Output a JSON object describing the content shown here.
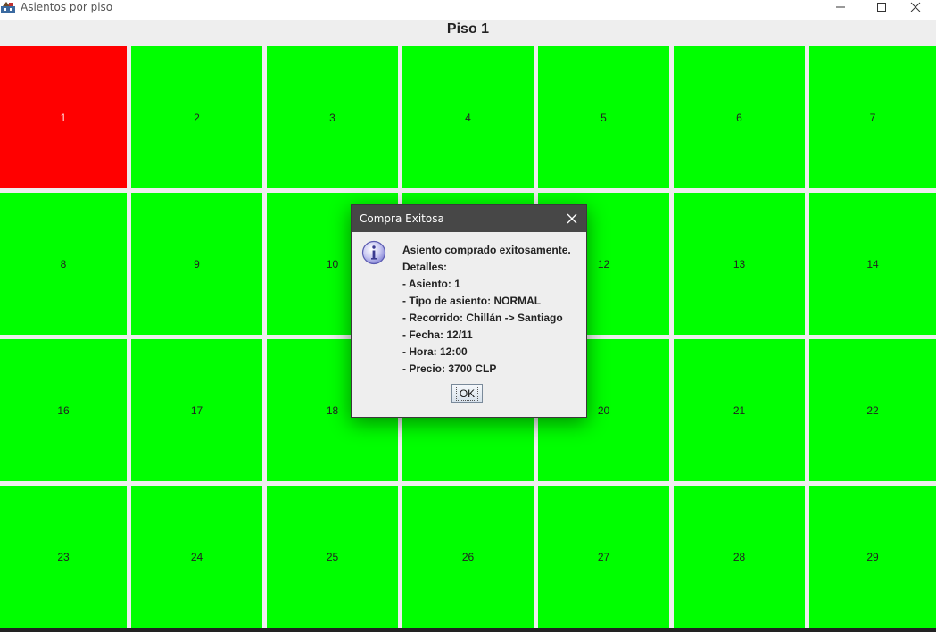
{
  "window": {
    "title": "Asientos por piso",
    "icon": "app-icon"
  },
  "floor": {
    "title": "Piso 1"
  },
  "colors": {
    "available": "#00ff00",
    "sold": "#ff0000"
  },
  "seats": [
    {
      "number": "1",
      "status": "sold"
    },
    {
      "number": "2",
      "status": "available"
    },
    {
      "number": "3",
      "status": "available"
    },
    {
      "number": "4",
      "status": "available"
    },
    {
      "number": "5",
      "status": "available"
    },
    {
      "number": "6",
      "status": "available"
    },
    {
      "number": "7",
      "status": "available"
    },
    {
      "number": "8",
      "status": "available"
    },
    {
      "number": "9",
      "status": "available"
    },
    {
      "number": "10",
      "status": "available"
    },
    {
      "number": "",
      "status": "available"
    },
    {
      "number": "12",
      "status": "available"
    },
    {
      "number": "13",
      "status": "available"
    },
    {
      "number": "14",
      "status": "available"
    },
    {
      "number": "16",
      "status": "available"
    },
    {
      "number": "17",
      "status": "available"
    },
    {
      "number": "18",
      "status": "available"
    },
    {
      "number": "",
      "status": "available"
    },
    {
      "number": "20",
      "status": "available"
    },
    {
      "number": "21",
      "status": "available"
    },
    {
      "number": "22",
      "status": "available"
    },
    {
      "number": "23",
      "status": "available"
    },
    {
      "number": "24",
      "status": "available"
    },
    {
      "number": "25",
      "status": "available"
    },
    {
      "number": "26",
      "status": "available"
    },
    {
      "number": "27",
      "status": "available"
    },
    {
      "number": "28",
      "status": "available"
    },
    {
      "number": "29",
      "status": "available"
    }
  ],
  "dialog": {
    "title": "Compra Exitosa",
    "icon": "info-icon",
    "lines": [
      "Asiento comprado exitosamente.",
      "Detalles:",
      "- Asiento: 1",
      "- Tipo de asiento: NORMAL",
      "- Recorrido: Chillán -> Santiago",
      "- Fecha: 12/11",
      "- Hora: 12:00",
      "- Precio: 3700 CLP"
    ],
    "ok_label": "OK"
  }
}
